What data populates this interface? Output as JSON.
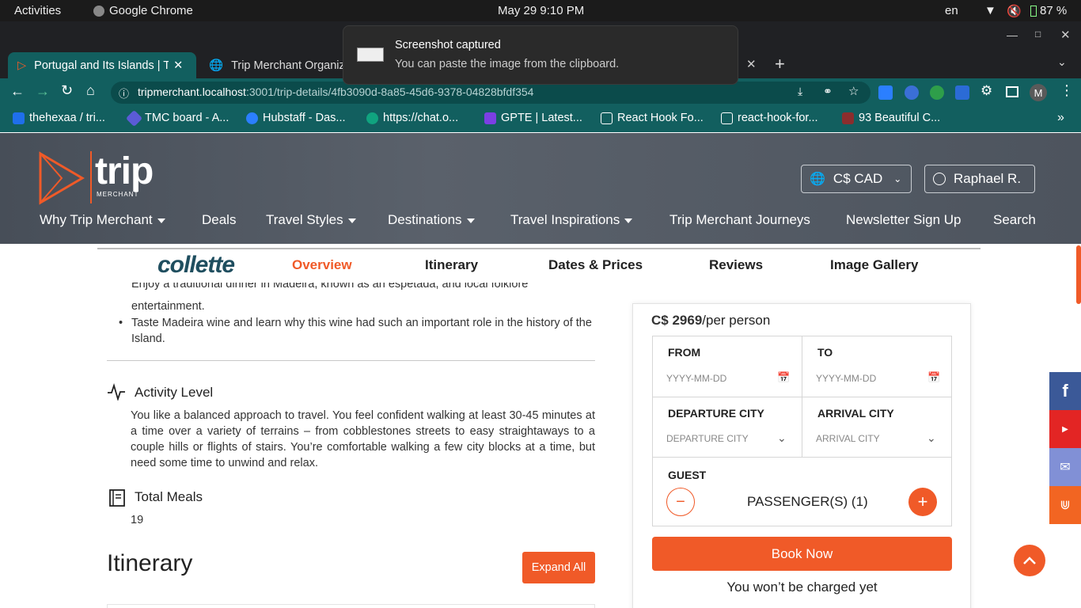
{
  "system": {
    "activities": "Activities",
    "app": "Google Chrome",
    "datetime": "May 29   9:10 PM",
    "lang": "en",
    "battery": "87 %"
  },
  "browser": {
    "tabs": [
      {
        "title": "Portugal and Its Islands | T"
      },
      {
        "title": "Trip Merchant Organiz"
      }
    ],
    "url_host": "tripmerchant.localhost",
    "url_path": ":3001/trip-details/4fb3090d-8a85-45d6-9378-04828bfdf354",
    "bookmarks": [
      {
        "label": "thehexaa / tri...",
        "color": "#1f6feb"
      },
      {
        "label": "TMC board - A...",
        "color": "#5b5bd6"
      },
      {
        "label": "Hubstaff - Das...",
        "color": "#2b7fff"
      },
      {
        "label": "https://chat.o...",
        "color": "#10a37f"
      },
      {
        "label": "GPTE | Latest...",
        "color": "#7b3fe4"
      },
      {
        "label": "React Hook Fo...",
        "color": "#125f5f"
      },
      {
        "label": "react-hook-for...",
        "color": "#125f5f"
      },
      {
        "label": "93 Beautiful C...",
        "color": "#8b2d2d"
      }
    ],
    "profile_initial": "M"
  },
  "notification": {
    "title": "Screenshot captured",
    "body": "You can paste the image from the clipboard."
  },
  "site": {
    "logo_text": "trip",
    "logo_sub": "MERCHANT",
    "currency": "C$ CAD",
    "user": "Raphael R.",
    "nav": [
      "Why Trip Merchant",
      "Deals",
      "Travel Styles",
      "Destinations",
      "Travel Inspirations",
      "Trip Merchant Journeys",
      "Newsletter Sign Up",
      "Search"
    ],
    "subnav": {
      "brand": "collette",
      "items": [
        "Overview",
        "Itinerary",
        "Dates & Prices",
        "Reviews",
        "Image Gallery"
      ]
    }
  },
  "content": {
    "bullet_partial_line1": "Enjoy a traditional dinner in Madeira, known as an espetada, and local folklore",
    "bullet_partial_line2": "entertainment.",
    "bullet2": "Taste Madeira wine and learn why this wine had such an important role in the history of the Island.",
    "activity_title": "Activity Level",
    "activity_text": "You like a balanced approach to travel. You feel confident walking at least 30-45 minutes at a time over a variety of terrains – from cobblestones streets to easy straightaways to a couple hills or flights of stairs. You’re comfortable walking a few city blocks at a time, but need some time to unwind and relax.",
    "meals_title": "Total Meals",
    "meals_value": "19",
    "itinerary_heading": "Itinerary",
    "expand_all": "Expand All"
  },
  "booking": {
    "price": "C$ 2969",
    "price_suffix": "/per person",
    "from_label": "FROM",
    "to_label": "TO",
    "date_placeholder": "YYYY-MM-DD",
    "departure_label": "DEPARTURE CITY",
    "departure_placeholder": "DEPARTURE CITY",
    "arrival_label": "ARRIVAL CITY",
    "arrival_placeholder": "ARRIVAL CITY",
    "guest_label": "GUEST",
    "passengers": "PASSENGER(S) (1)",
    "book_now": "Book Now",
    "note": "You won’t be charged yet"
  },
  "colors": {
    "accent": "#f05a28",
    "chrome_teal": "#125f5f",
    "header_gray": "#50575f"
  }
}
